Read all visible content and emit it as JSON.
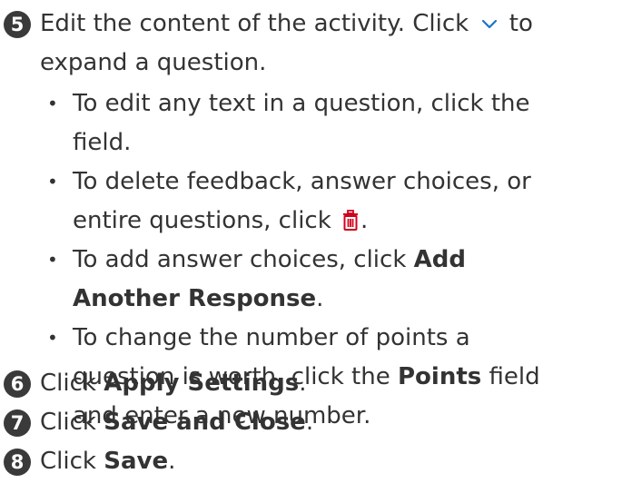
{
  "step5": {
    "number": "5",
    "line1_before": "Edit the content of the activity. Click",
    "line1_after": "to",
    "line2": "expand a question.",
    "bullets": [
      {
        "lines": [
          "To edit any text in a question, click the",
          "field."
        ]
      },
      {
        "line1": "To delete feedback, answer choices, or",
        "line2_before": "entire questions, click",
        "line2_after": "."
      },
      {
        "line1_before": "To add answer choices, click",
        "line1_bold": "Add",
        "line2_bold": "Another Response",
        "line2_after": "."
      },
      {
        "line1": "To change the number of points a",
        "line2_before": "question is worth, click the",
        "line2_bold": "Points",
        "line2_after": "field",
        "line3": "and enter a new number."
      }
    ]
  },
  "step6": {
    "number": "6",
    "before": "Click",
    "bold": "Apply Settings",
    "after": "."
  },
  "step7": {
    "number": "7",
    "before": "Click",
    "bold": "Save and Close",
    "after": "."
  },
  "step8": {
    "number": "8",
    "before": "Click",
    "bold": "Save",
    "after": "."
  },
  "icons": {
    "expand": "chevron-down-icon",
    "delete": "trash-icon"
  },
  "colors": {
    "text": "#333333",
    "badge": "#3a3a3a",
    "chevron": "#1a73c8",
    "trash": "#d0021b"
  }
}
